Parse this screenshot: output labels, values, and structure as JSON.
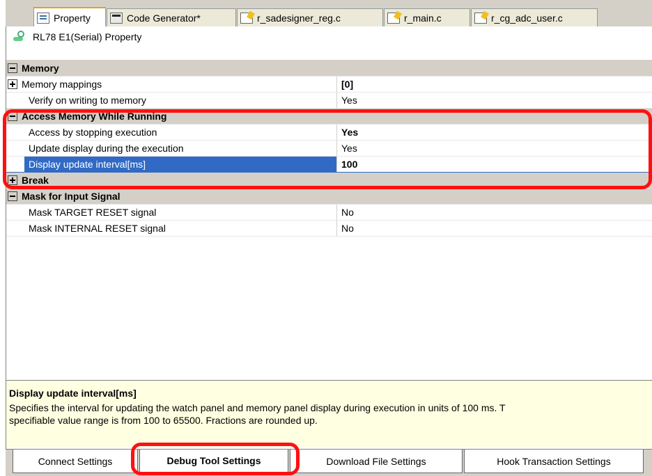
{
  "tabs": [
    {
      "label": "Property",
      "icon": "property-icon"
    },
    {
      "label": "Code Generator*",
      "icon": "code-generator-icon"
    },
    {
      "label": "r_sadesigner_reg.c",
      "icon": "c-file-icon"
    },
    {
      "label": "r_main.c",
      "icon": "c-file-icon"
    },
    {
      "label": "r_cg_adc_user.c",
      "icon": "c-file-icon"
    }
  ],
  "panel_title": "RL78 E1(Serial) Property",
  "categories": {
    "memory": {
      "label": "Memory",
      "rows": [
        {
          "name": "Memory mappings",
          "value": "[0]"
        },
        {
          "name": "Verify on writing to memory",
          "value": "Yes"
        }
      ]
    },
    "access": {
      "label": "Access Memory While Running",
      "rows": [
        {
          "name": "Access by stopping execution",
          "value": "Yes"
        },
        {
          "name": "Update display during the execution",
          "value": "Yes"
        },
        {
          "name": "Display update interval[ms]",
          "value": "100"
        }
      ]
    },
    "break": {
      "label": "Break"
    },
    "mask": {
      "label": "Mask for Input Signal",
      "rows": [
        {
          "name": "Mask TARGET RESET signal",
          "value": "No"
        },
        {
          "name": "Mask INTERNAL RESET signal",
          "value": "No"
        }
      ]
    }
  },
  "description": {
    "title": "Display update interval[ms]",
    "line1": "Specifies the interval for updating the watch panel and memory panel display during execution in units of 100 ms. T",
    "line2": "specifiable value range is from 100 to 65500. Fractions are rounded up."
  },
  "bottom_tabs": [
    {
      "label": "Connect Settings"
    },
    {
      "label": "Debug Tool Settings"
    },
    {
      "label": "Download File Settings"
    },
    {
      "label": "Hook Transaction Settings"
    }
  ],
  "colors": {
    "highlight": "#ff1010",
    "selection": "#316ac5",
    "description_bg": "#ffffe1"
  }
}
